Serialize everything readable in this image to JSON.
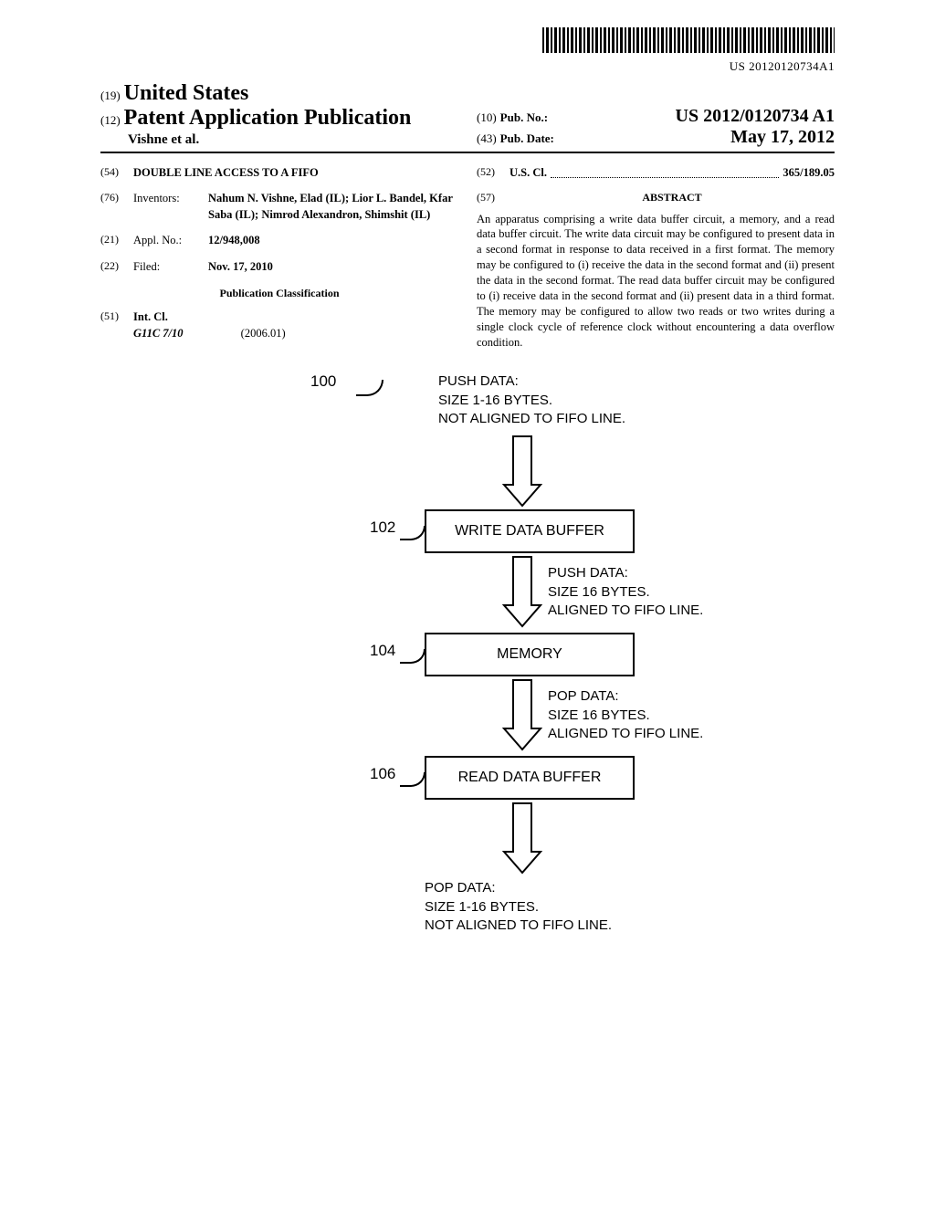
{
  "barcode_number": "US 20120120734A1",
  "header": {
    "code19": "(19)",
    "country": "United States",
    "code12": "(12)",
    "doc_type": "Patent Application Publication",
    "authors_line": "Vishne et al.",
    "code10": "(10)",
    "pubno_label": "Pub. No.:",
    "pubno": "US 2012/0120734 A1",
    "code43": "(43)",
    "pubdate_label": "Pub. Date:",
    "pubdate": "May 17, 2012"
  },
  "left": {
    "code54": "(54)",
    "title": "DOUBLE LINE ACCESS TO A FIFO",
    "code76": "(76)",
    "inventors_label": "Inventors:",
    "inventors_val": "Nahum N. Vishne, Elad (IL); Lior L. Bandel, Kfar Saba (IL); Nimrod Alexandron, Shimshit (IL)",
    "code21": "(21)",
    "applno_label": "Appl. No.:",
    "applno": "12/948,008",
    "code22": "(22)",
    "filed_label": "Filed:",
    "filed": "Nov. 17, 2010",
    "pub_class": "Publication Classification",
    "code51": "(51)",
    "intcl_label": "Int. Cl.",
    "intcl_code": "G11C 7/10",
    "intcl_year": "(2006.01)"
  },
  "right": {
    "code52": "(52)",
    "uscl_label": "U.S. Cl.",
    "uscl_val": "365/189.05",
    "code57": "(57)",
    "abstract_heading": "ABSTRACT",
    "abstract_text": "An apparatus comprising a write data buffer circuit, a memory, and a read data buffer circuit. The write data circuit may be configured to present data in a second format in response to data received in a first format. The memory may be configured to (i) receive the data in the second format and (ii) present the data in the second format. The read data buffer circuit may be configured to (i) receive data in the second format and (ii) present data in a third format. The memory may be configured to allow two reads or two writes during a single clock cycle of reference clock without encountering a data overflow condition."
  },
  "figure": {
    "ref100": "100",
    "push_top_l1": "PUSH DATA:",
    "push_top_l2": "SIZE 1-16 BYTES.",
    "push_top_l3": "NOT ALIGNED TO FIFO LINE.",
    "ref102": "102",
    "box102": "WRITE DATA BUFFER",
    "mid1_l1": "PUSH DATA:",
    "mid1_l2": "SIZE 16 BYTES.",
    "mid1_l3": "ALIGNED TO FIFO LINE.",
    "ref104": "104",
    "box104": "MEMORY",
    "mid2_l1": "POP DATA:",
    "mid2_l2": "SIZE 16 BYTES.",
    "mid2_l3": "ALIGNED TO FIFO LINE.",
    "ref106": "106",
    "box106": "READ DATA BUFFER",
    "pop_bot_l1": "POP DATA:",
    "pop_bot_l2": "SIZE 1-16 BYTES.",
    "pop_bot_l3": "NOT ALIGNED TO FIFO LINE."
  }
}
